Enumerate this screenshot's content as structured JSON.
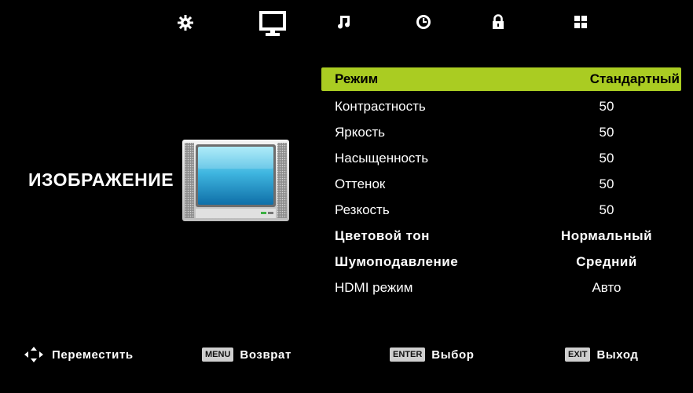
{
  "tabs": [
    {
      "name": "settings",
      "icon": "gear-icon"
    },
    {
      "name": "picture",
      "icon": "monitor-icon",
      "active": true
    },
    {
      "name": "sound",
      "icon": "music-note-icon"
    },
    {
      "name": "time",
      "icon": "clock-icon"
    },
    {
      "name": "lock",
      "icon": "lock-icon"
    },
    {
      "name": "setup",
      "icon": "grid-icon"
    }
  ],
  "section": {
    "title": "ИЗОБРАЖЕНИЕ"
  },
  "menu": {
    "items": [
      {
        "label": "Режим",
        "value": "Стандартный"
      },
      {
        "label": "Контрастность",
        "value": "50"
      },
      {
        "label": "Яркость",
        "value": "50"
      },
      {
        "label": "Насыщенность",
        "value": "50"
      },
      {
        "label": "Оттенок",
        "value": "50"
      },
      {
        "label": "Резкость",
        "value": "50"
      },
      {
        "label": "Цветовой тон",
        "value": "Нормальный"
      },
      {
        "label": "Шумоподавление",
        "value": "Средний"
      },
      {
        "label": "HDMI режим",
        "value": "Авто"
      }
    ]
  },
  "footer": {
    "move": {
      "label": "Переместить"
    },
    "back": {
      "key": "MENU",
      "label": "Возврат"
    },
    "select": {
      "key": "ENTER",
      "label": "Выбор"
    },
    "exit": {
      "key": "EXIT",
      "label": "Выход"
    }
  },
  "colors": {
    "highlight": "#aacc22",
    "background": "#000000"
  }
}
